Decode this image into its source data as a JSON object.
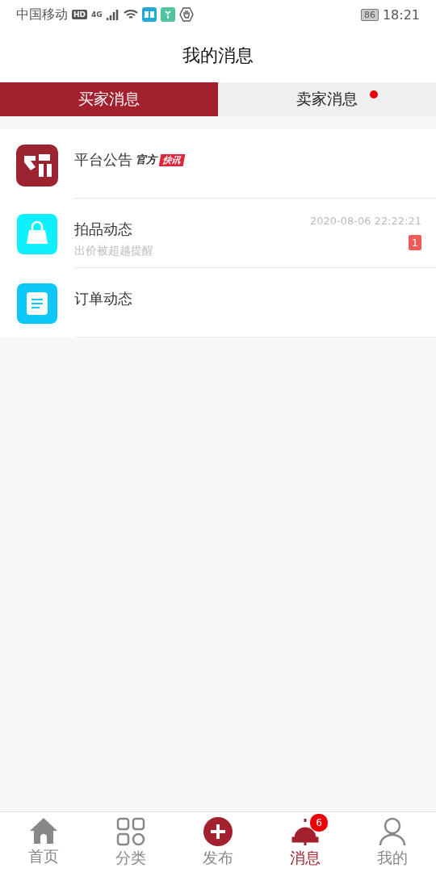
{
  "status_bar": {
    "carrier": "中国移动",
    "hd": "HD",
    "network": "4G",
    "battery": "86",
    "time": "18:21"
  },
  "title": "我的消息",
  "tabs": [
    {
      "label": "买家消息",
      "selected": true,
      "dot": false
    },
    {
      "label": "卖家消息",
      "selected": false,
      "dot": true
    }
  ],
  "messages": [
    {
      "kind": "brand",
      "title": "平台公告",
      "tag": "官方",
      "tag_badge": "快讯"
    },
    {
      "kind": "bag",
      "title": "拍品动态",
      "subtitle": "出价被超越提醒",
      "time": "2020-08-06 22:22:21",
      "count": "1"
    },
    {
      "kind": "doc",
      "title": "订单动态"
    }
  ],
  "nav": [
    {
      "kind": "home",
      "label": "首页",
      "selected": false
    },
    {
      "kind": "grid",
      "label": "分类",
      "selected": false
    },
    {
      "kind": "plus",
      "label": "发布",
      "selected": false
    },
    {
      "kind": "bell",
      "label": "消息",
      "selected": true,
      "badge": "6"
    },
    {
      "kind": "user",
      "label": "我的",
      "selected": false
    }
  ]
}
